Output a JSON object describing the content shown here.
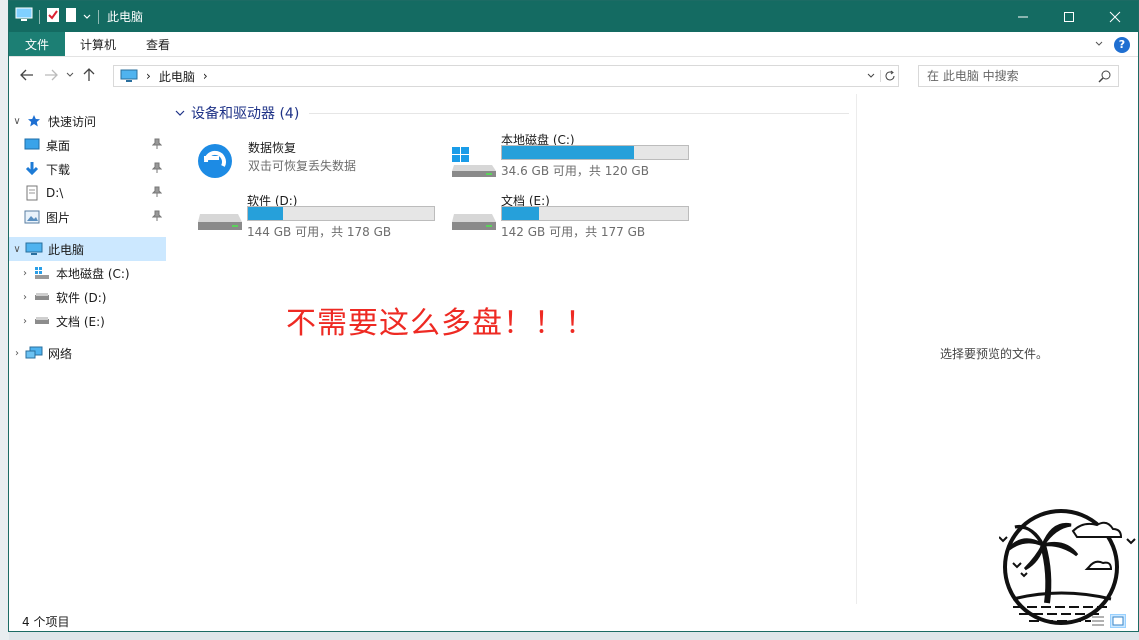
{
  "window": {
    "title": "此电脑",
    "controls": {
      "minimize_icon": "minimize-icon",
      "maximize_icon": "maximize-icon",
      "close_icon": "close-icon"
    }
  },
  "ribbon": {
    "tabs": [
      {
        "label": "文件",
        "active": true
      },
      {
        "label": "计算机",
        "active": false
      },
      {
        "label": "查看",
        "active": false
      }
    ],
    "help": "?"
  },
  "navbar": {
    "breadcrumb": [
      "此电脑"
    ],
    "search_placeholder": "在 此电脑 中搜索"
  },
  "navpane": {
    "items": [
      {
        "label": "快速访问",
        "icon": "star-icon",
        "expand": "∨"
      },
      {
        "label": "桌面",
        "icon": "desktop-icon",
        "pinned": true
      },
      {
        "label": "下载",
        "icon": "download-icon",
        "pinned": true
      },
      {
        "label": "D:\\",
        "icon": "document-icon",
        "pinned": true
      },
      {
        "label": "图片",
        "icon": "pictures-icon",
        "pinned": true
      },
      {
        "label": "此电脑",
        "icon": "computer-icon",
        "expand": "∨",
        "selected": true
      },
      {
        "label": "本地磁盘 (C:)",
        "icon": "windows-drive-icon",
        "expand": "›"
      },
      {
        "label": "软件 (D:)",
        "icon": "drive-icon",
        "expand": "›"
      },
      {
        "label": "文档 (E:)",
        "icon": "drive-icon",
        "expand": "›"
      },
      {
        "label": "网络",
        "icon": "network-icon",
        "expand": "›"
      }
    ]
  },
  "content": {
    "group_title": "设备和驱动器 (4)",
    "items": [
      {
        "name": "数据恢复",
        "sub": "双击可恢复丢失数据",
        "icon": "data-recovery-icon"
      },
      {
        "name": "本地磁盘 (C:)",
        "sub": "34.6 GB 可用，共 120 GB",
        "used_fraction": 0.71,
        "icon": "windows-drive-icon"
      },
      {
        "name": "软件 (D:)",
        "sub": "144 GB 可用，共 178 GB",
        "used_fraction": 0.19,
        "icon": "drive-icon"
      },
      {
        "name": "文档 (E:)",
        "sub": "142 GB 可用，共 177 GB",
        "used_fraction": 0.2,
        "icon": "drive-icon"
      }
    ],
    "annotation": "不需要这么多盘！！！"
  },
  "preview": {
    "message": "选择要预览的文件。"
  },
  "status": {
    "count": "4 个项目"
  },
  "colors": {
    "titlebar": "#146b62",
    "file_tab": "#1c7f74",
    "drive_bar": "#26a0da",
    "annotation": "#ee2a23",
    "selection": "#cce8ff"
  }
}
